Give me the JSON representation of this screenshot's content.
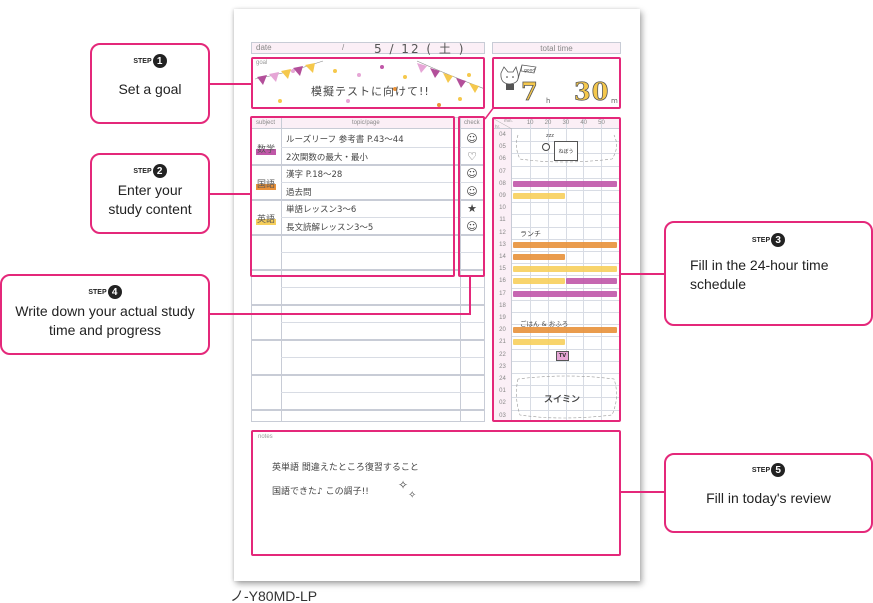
{
  "planner": {
    "model": "ノ-Y80MD-LP",
    "date": {
      "label": "date",
      "slash": "/",
      "value": "5 / 12 ( 土 )"
    },
    "total_time": {
      "label": "total time",
      "hours": "7",
      "hours_unit": "h",
      "minutes": "30",
      "minutes_unit": "m",
      "sticker": "good"
    },
    "goal": {
      "label": "goal",
      "text": "模擬テストに向けて!!"
    },
    "table": {
      "headers": {
        "subject": "subject",
        "topic": "topic/page",
        "check": "check"
      },
      "subjects": [
        {
          "name": "数学",
          "color": "#c057a8",
          "rows": [
            {
              "topic": "ルーズリーフ 参考書 P.43～44",
              "check": "☺"
            },
            {
              "topic": "2次関数の最大・最小",
              "check": "♡"
            }
          ]
        },
        {
          "name": "国語",
          "color": "#e8913a",
          "rows": [
            {
              "topic": "漢字 P.18～28",
              "check": "☺"
            },
            {
              "topic": "過去問",
              "check": "☺"
            }
          ]
        },
        {
          "name": "英語",
          "color": "#f7cf5c",
          "rows": [
            {
              "topic": "単語レッスン3～6",
              "check": "★"
            },
            {
              "topic": "長文読解レッスン3～5",
              "check": "☺"
            }
          ]
        }
      ]
    },
    "timeline": {
      "corner_min": "min.",
      "corner_hr": "hr.",
      "minutes": [
        "10",
        "20",
        "30",
        "40",
        "50"
      ],
      "hours": [
        "04",
        "05",
        "06",
        "07",
        "08",
        "09",
        "10",
        "11",
        "12",
        "13",
        "14",
        "15",
        "16",
        "17",
        "18",
        "19",
        "20",
        "21",
        "22",
        "23",
        "24",
        "01",
        "02",
        "03"
      ],
      "blocks": [
        {
          "hour": "08",
          "start_min": 0,
          "end_min": 60,
          "color": "#c057a8"
        },
        {
          "hour": "09",
          "start_min": 0,
          "end_min": 30,
          "color": "#f7cf5c"
        },
        {
          "hour": "13",
          "start_min": 0,
          "end_min": 60,
          "color": "#e8913a"
        },
        {
          "hour": "14",
          "start_min": 0,
          "end_min": 30,
          "color": "#e8913a"
        },
        {
          "hour": "15",
          "start_min": 0,
          "end_min": 60,
          "color": "#f7cf5c"
        },
        {
          "hour": "16",
          "start_min": 0,
          "end_min": 30,
          "color": "#f7cf5c"
        },
        {
          "hour": "16",
          "start_min": 30,
          "end_min": 60,
          "color": "#c057a8"
        },
        {
          "hour": "17",
          "start_min": 0,
          "end_min": 60,
          "color": "#c057a8"
        },
        {
          "hour": "20",
          "start_min": 0,
          "end_min": 60,
          "color": "#e8913a"
        },
        {
          "hour": "21",
          "start_min": 0,
          "end_min": 30,
          "color": "#f7cf5c"
        }
      ],
      "annotations": {
        "sleep_morning": "zzz",
        "alarm": "ねぼう",
        "lunch": "ランチ",
        "dinner_bath": "ごはん & おふろ",
        "tv": "TV",
        "night_sleep": "スイミン"
      }
    },
    "notes": {
      "label": "notes",
      "line1": "英単語 間違えたところ復習すること",
      "line2": "国語できた♪ この調子!!"
    }
  },
  "callouts": [
    {
      "step_word": "STEP",
      "number": "1",
      "text": "Set a goal"
    },
    {
      "step_word": "STEP",
      "number": "2",
      "text": "Enter your study content"
    },
    {
      "step_word": "STEP",
      "number": "3",
      "text": "Fill in the 24-hour time schedule"
    },
    {
      "step_word": "STEP",
      "number": "4",
      "text": "Write down your actual study time and progress"
    },
    {
      "step_word": "STEP",
      "number": "5",
      "text": "Fill in today's review"
    }
  ],
  "colors": {
    "accent": "#e4287a",
    "header_fill": "#fbeff6",
    "math": "#c057a8",
    "japanese": "#e8913a",
    "english": "#f7cf5c"
  }
}
